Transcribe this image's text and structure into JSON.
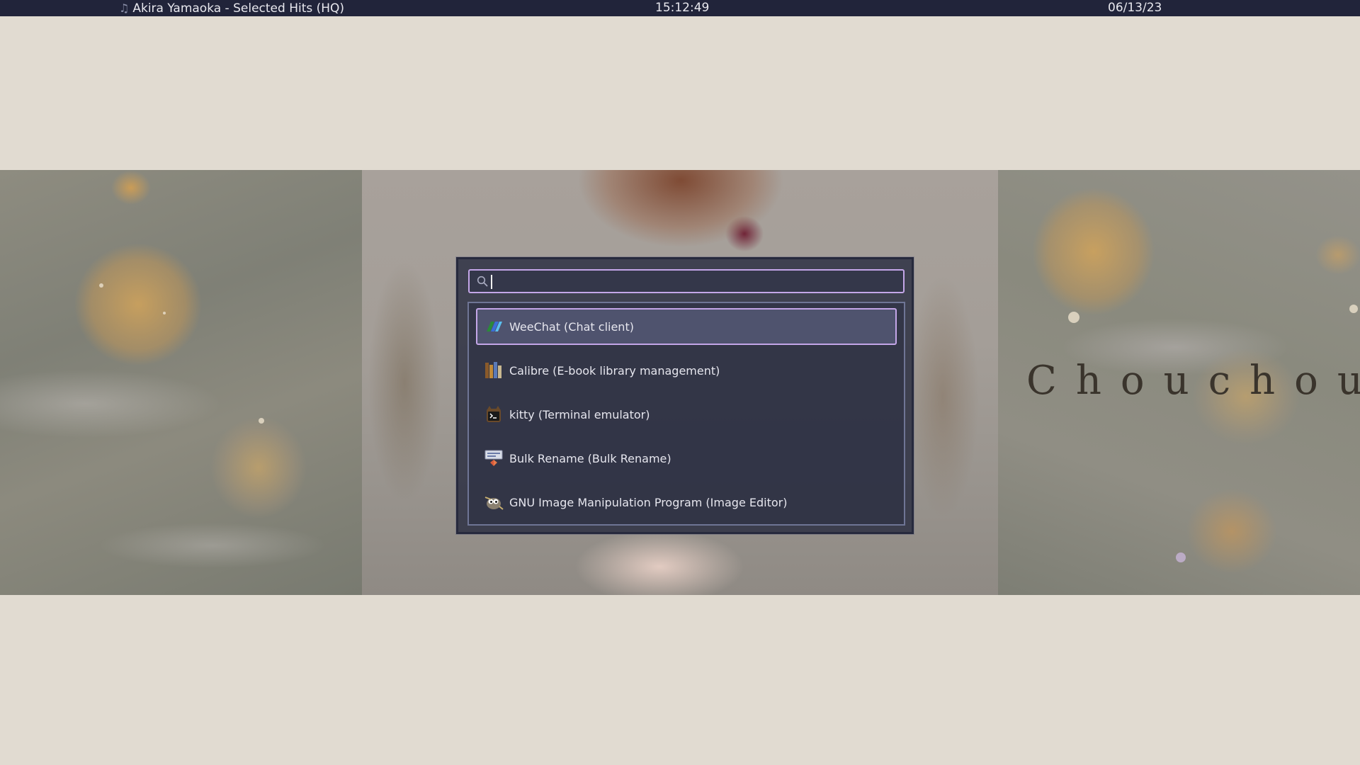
{
  "topbar": {
    "music_icon": "music-note-icon",
    "now_playing": "Akira Yamaoka - Selected Hits (HQ)",
    "time": "15:12:49",
    "date": "06/13/23"
  },
  "wallpaper": {
    "text": "Chouchou"
  },
  "launcher": {
    "search": {
      "icon": "search-icon",
      "value": "",
      "placeholder": ""
    },
    "results": [
      {
        "label": "WeeChat (Chat client)",
        "icon": "weechat-icon",
        "selected": true
      },
      {
        "label": "Calibre (E-book library management)",
        "icon": "calibre-icon",
        "selected": false
      },
      {
        "label": "kitty (Terminal emulator)",
        "icon": "kitty-icon",
        "selected": false
      },
      {
        "label": "Bulk Rename (Bulk Rename)",
        "icon": "bulk-rename-icon",
        "selected": false
      },
      {
        "label": "GNU Image Manipulation Program (Image Editor)",
        "icon": "gimp-icon",
        "selected": false
      }
    ]
  },
  "colors": {
    "topbar_bg": "#21243a",
    "desktop_bg": "#e1dbd1",
    "launcher_bg": "#282c40",
    "accent": "#c4a6e8",
    "results_border": "#6f7595"
  }
}
